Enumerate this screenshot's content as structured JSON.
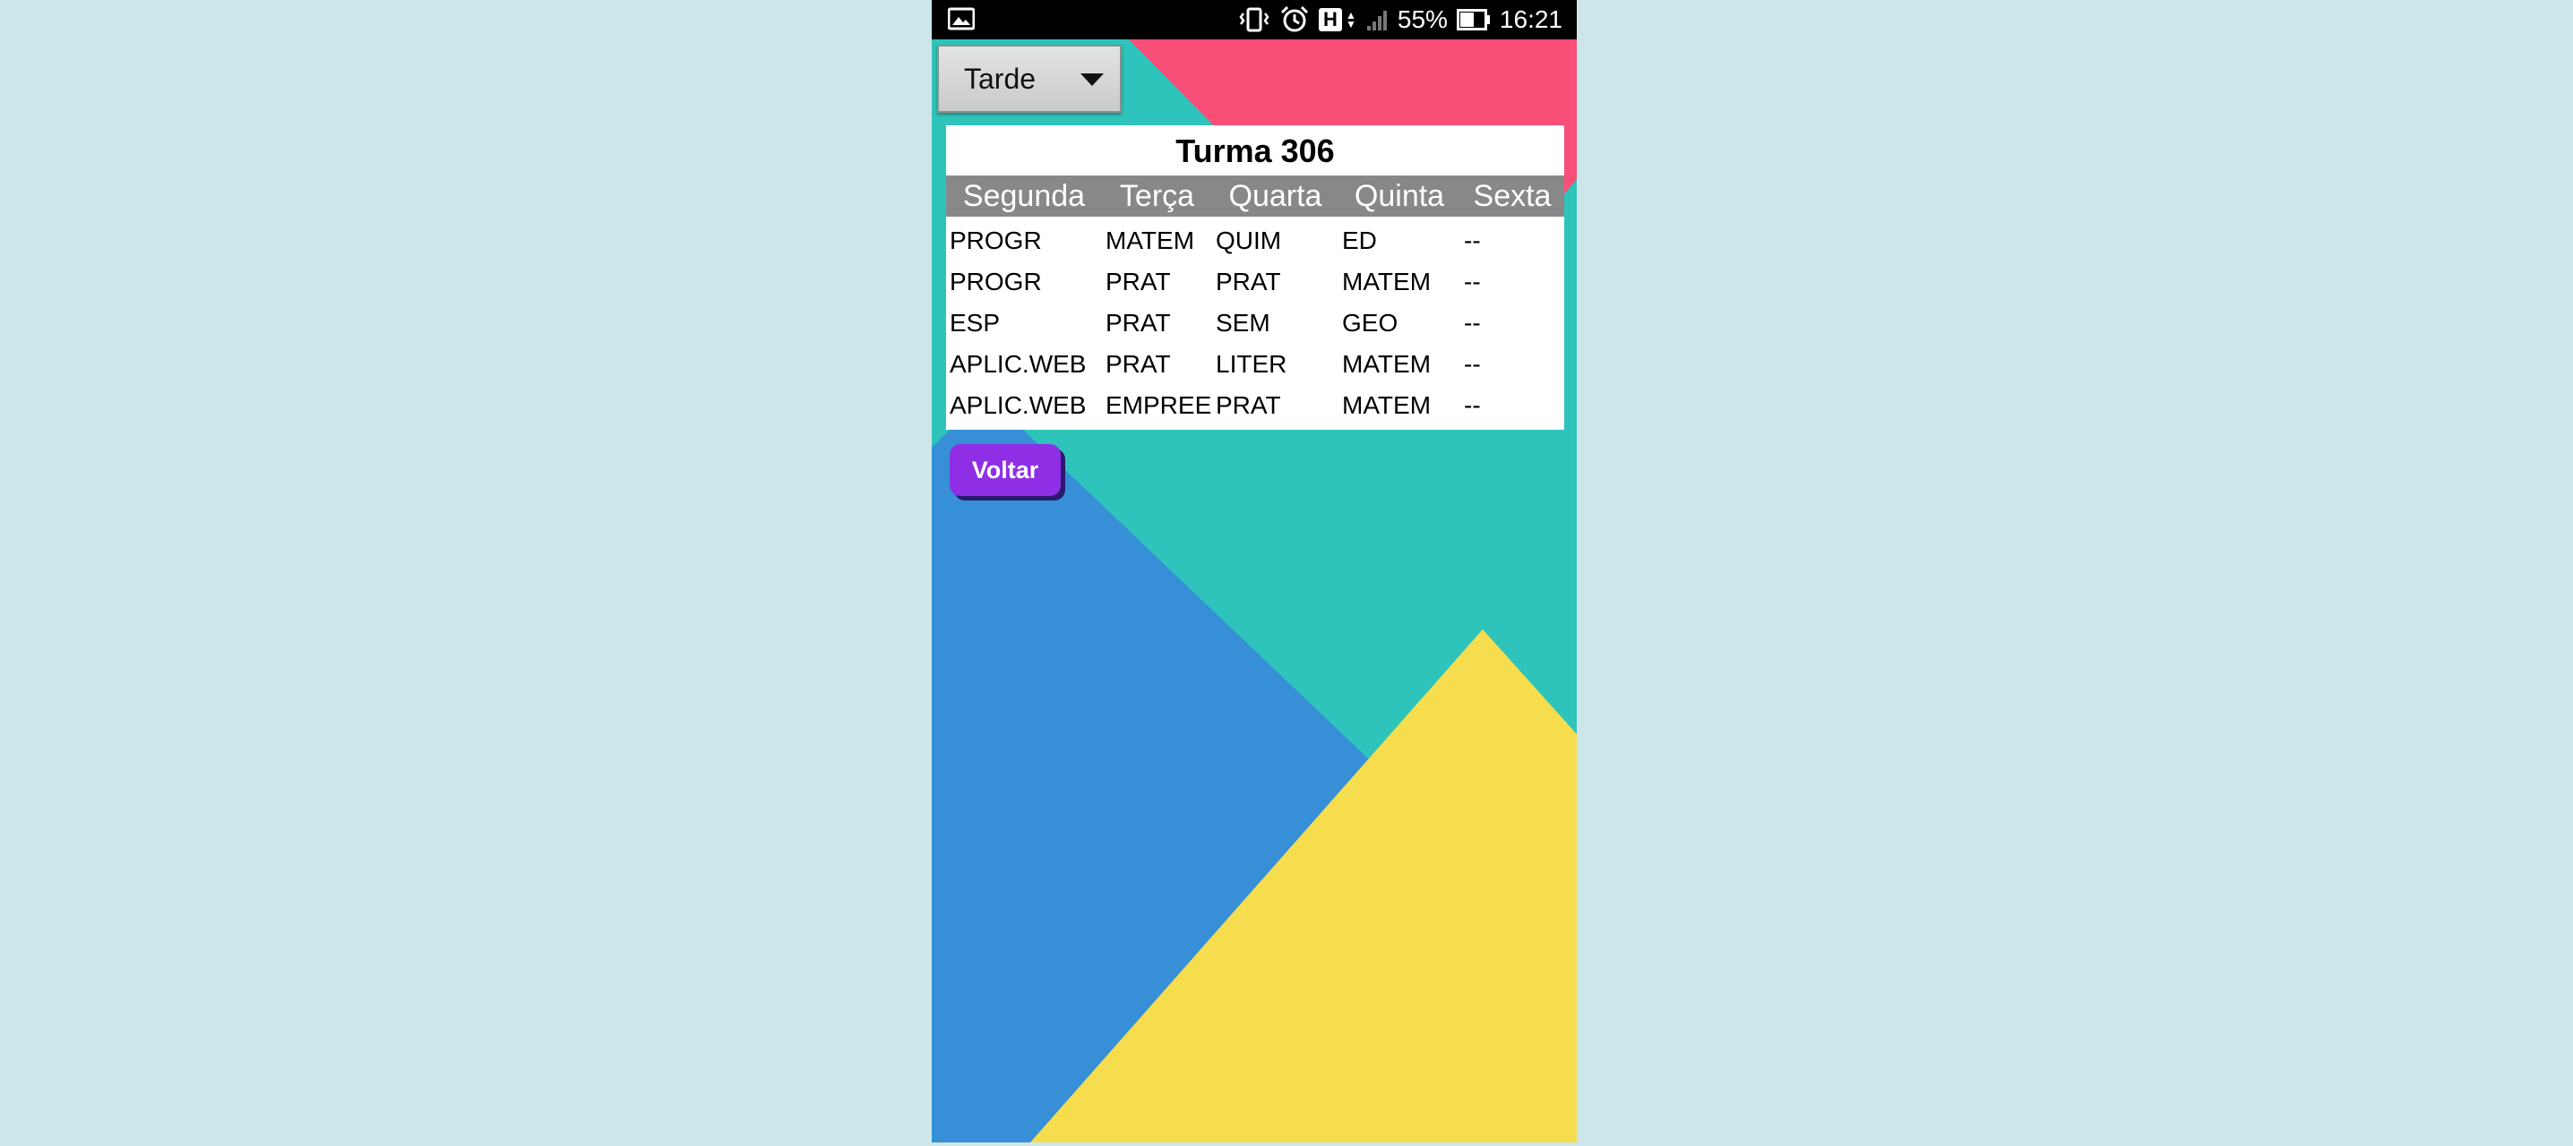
{
  "status_bar": {
    "battery": "55%",
    "time": "16:21",
    "network_badge": "H"
  },
  "period_spinner": {
    "selected": "Tarde"
  },
  "schedule": {
    "title": "Turma 306",
    "columns": [
      "Segunda",
      "Terça",
      "Quarta",
      "Quinta",
      "Sexta"
    ],
    "rows": [
      [
        "PROGR",
        "MATEM",
        "QUIM",
        "ED",
        "--"
      ],
      [
        "PROGR",
        "PRAT",
        "PRAT",
        "MATEM",
        "--"
      ],
      [
        "ESP",
        "PRAT",
        "SEM",
        "GEO",
        "--"
      ],
      [
        "APLIC.WEB",
        "PRAT",
        "LITER",
        "MATEM",
        "--"
      ],
      [
        "APLIC.WEB",
        "EMPREE",
        "PRAT",
        "MATEM",
        "--"
      ]
    ]
  },
  "back_button": {
    "label": "Voltar"
  },
  "colors": {
    "wallpaper_teal": "#2ec4bb",
    "wallpaper_pink": "#f74f78",
    "wallpaper_blue": "#368fd7",
    "wallpaper_yellow": "#f6dd4e",
    "header_gray": "#888888",
    "button_purple": "#8e2fe6"
  }
}
